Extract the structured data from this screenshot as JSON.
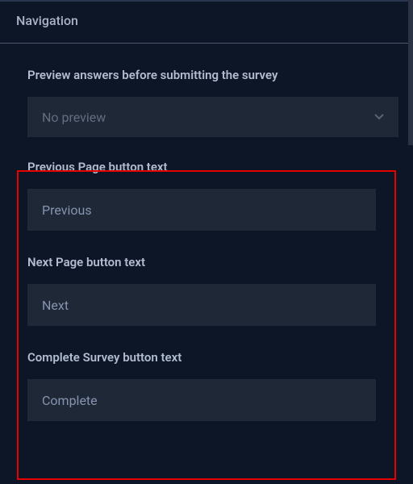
{
  "header": {
    "title": "Navigation"
  },
  "preview": {
    "label": "Preview answers before submitting the survey",
    "selected": "No preview"
  },
  "buttons": {
    "prev": {
      "label": "Previous Page button text",
      "value": "Previous"
    },
    "next": {
      "label": "Next Page button text",
      "value": "Next"
    },
    "complete": {
      "label": "Complete Survey button text",
      "value": "Complete"
    }
  }
}
